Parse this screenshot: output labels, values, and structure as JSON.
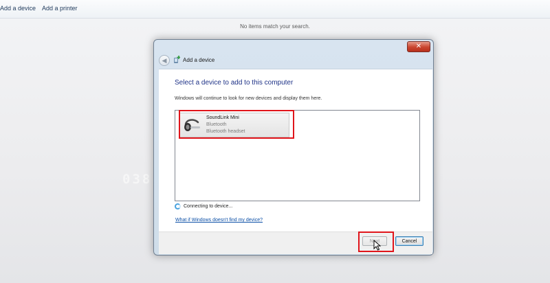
{
  "toolbar": {
    "add_device": "Add a device",
    "add_printer": "Add a printer"
  },
  "explorer": {
    "empty_message": "No items match your search."
  },
  "watermark": "038 869 1824",
  "dialog": {
    "title": "Add a device",
    "close_label": "✕",
    "back_label": "◀",
    "heading": "Select a device to add to this computer",
    "subtext": "Windows will continue to look for new devices and display them here.",
    "devices": [
      {
        "name": "SoundLink Mini",
        "type": "Bluetooth",
        "subtype": "Bluetooth headset"
      }
    ],
    "status": "Connecting to device...",
    "help_link": "What if Windows doesn't find my device?",
    "next_label": "Next",
    "cancel_label": "Cancel"
  },
  "colors": {
    "highlight": "#e0141a",
    "heading": "#1e3287",
    "link": "#0a4ea6"
  },
  "icons": {
    "back": "back-arrow-icon",
    "title": "add-device-icon",
    "device": "bluetooth-headset-icon",
    "spinner": "loading-spinner-icon",
    "cursor": "mouse-cursor-icon"
  }
}
